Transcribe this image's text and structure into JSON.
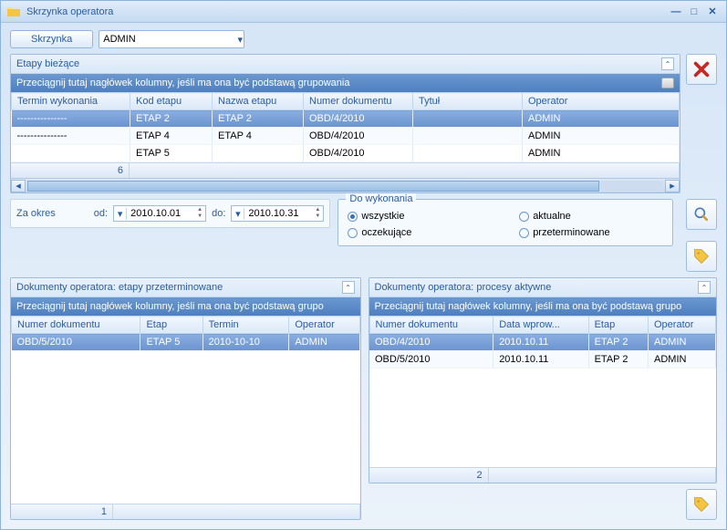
{
  "window": {
    "title": "Skrzynka operatora"
  },
  "toolbar": {
    "skrzynka_btn": "Skrzynka",
    "user_combo": "ADMIN"
  },
  "etapy": {
    "title": "Etapy bieżące",
    "group_hint": "Przeciągnij tutaj nagłówek kolumny, jeśli ma ona być podstawą grupowania",
    "cols": [
      "Termin wykonania",
      "Kod etapu",
      "Nazwa etapu",
      "Numer dokumentu",
      "Tytuł",
      "Operator"
    ],
    "rows": [
      {
        "termin": "---------------",
        "kod": "ETAP 2",
        "nazwa": "ETAP 2",
        "numer": "OBD/4/2010",
        "tytul": "",
        "operator": "ADMIN",
        "sel": true
      },
      {
        "termin": "---------------",
        "kod": "ETAP 4",
        "nazwa": "ETAP 4",
        "numer": "OBD/4/2010",
        "tytul": "",
        "operator": "ADMIN"
      },
      {
        "termin": "",
        "kod": "ETAP 5",
        "nazwa": "",
        "numer": "OBD/4/2010",
        "tytul": "",
        "operator": "ADMIN"
      }
    ],
    "footer_count": "6"
  },
  "period": {
    "label": "Za okres",
    "od_label": "od:",
    "do_label": "do:",
    "od_value": "2010.10.01",
    "do_value": "2010.10.31"
  },
  "dowyk": {
    "legend": "Do wykonania",
    "options": {
      "wszystkie": "wszystkie",
      "aktualne": "aktualne",
      "oczekujace": "oczekujące",
      "przeterminowane": "przeterminowane"
    },
    "selected": "wszystkie"
  },
  "overdue": {
    "title": "Dokumenty operatora: etapy przeterminowane",
    "group_hint": "Przeciągnij tutaj nagłówek kolumny, jeśli ma ona być podstawą grupo",
    "cols": [
      "Numer dokumentu",
      "Etap",
      "Termin",
      "Operator"
    ],
    "rows": [
      {
        "numer": "OBD/5/2010",
        "etap": "ETAP 5",
        "termin": "2010-10-10",
        "operator": "ADMIN",
        "sel": true
      }
    ],
    "footer_count": "1"
  },
  "active": {
    "title": "Dokumenty operatora: procesy aktywne",
    "group_hint": "Przeciągnij tutaj nagłówek kolumny, jeśli ma ona być podstawą grupo",
    "cols": [
      "Numer dokumentu",
      "Data wprow...",
      "Etap",
      "Operator"
    ],
    "rows": [
      {
        "numer": "OBD/4/2010",
        "data": "2010.10.11",
        "etap": "ETAP 2",
        "operator": "ADMIN",
        "sel": true
      },
      {
        "numer": "OBD/5/2010",
        "data": "2010.10.11",
        "etap": "ETAP 2",
        "operator": "ADMIN"
      }
    ],
    "footer_count": "2"
  },
  "colors": {
    "accent": "#2a5ca0"
  }
}
